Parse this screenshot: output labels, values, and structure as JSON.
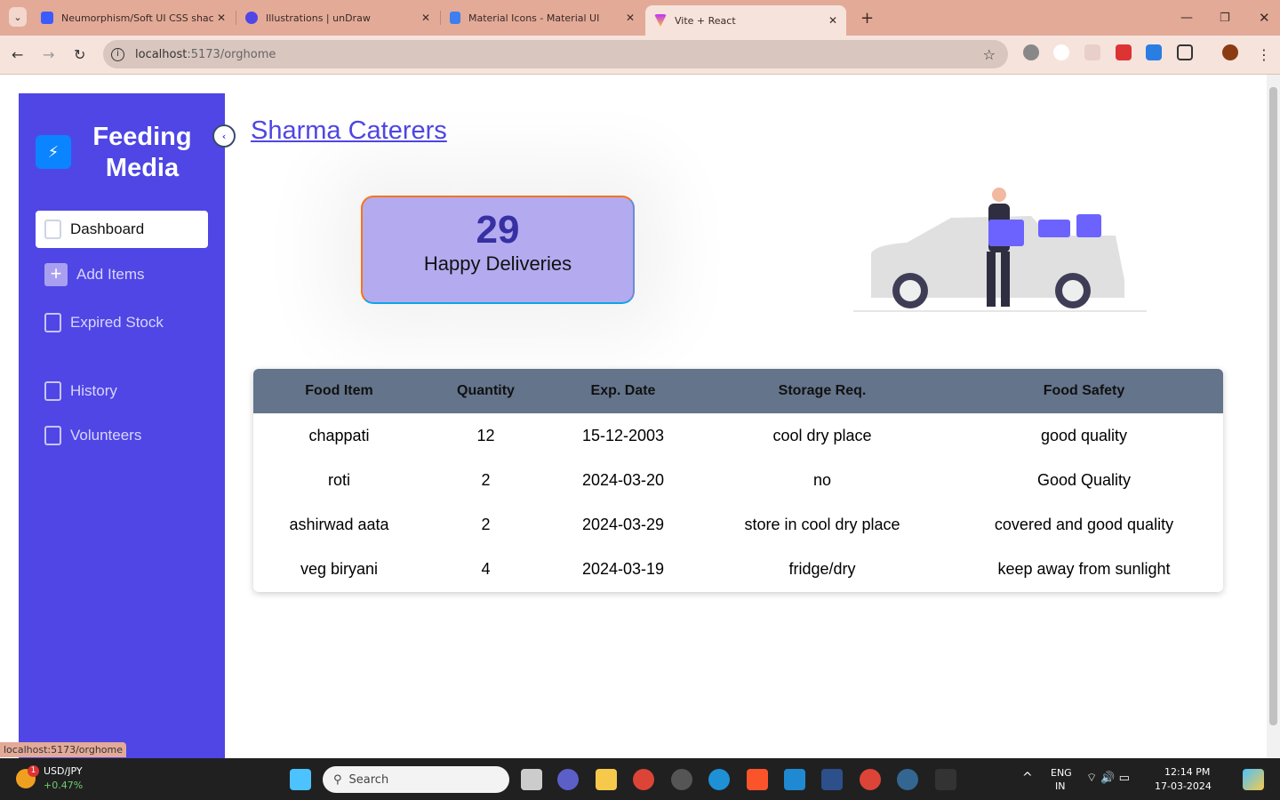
{
  "browser": {
    "tabs": [
      {
        "title": "Neumorphism/Soft UI CSS shac",
        "icon": "blue-square-icon"
      },
      {
        "title": "Illustrations | unDraw",
        "icon": "undraw-icon"
      },
      {
        "title": "Material Icons - Material UI",
        "icon": "mui-icon"
      },
      {
        "title": "Vite + React",
        "icon": "vite-icon",
        "active": true
      }
    ],
    "url_host": "localhost",
    "url_rest": ":5173/orghome",
    "status_url": "localhost:5173/orghome"
  },
  "sidebar": {
    "brand": "Feeding Media",
    "items": [
      {
        "label": "Dashboard",
        "active": true,
        "icon": "calendar-icon"
      },
      {
        "label": "Add Items",
        "icon": "plus-icon"
      },
      {
        "label": "Expired Stock",
        "icon": "calendar-icon"
      },
      {
        "label": "History",
        "icon": "chart-icon"
      },
      {
        "label": "Volunteers",
        "icon": "folder-icon"
      }
    ]
  },
  "main": {
    "title": "Sharma Caterers",
    "stat": {
      "value": "29",
      "label": "Happy Deliveries"
    },
    "table": {
      "headers": [
        "Food Item",
        "Quantity",
        "Exp. Date",
        "Storage Req.",
        "Food Safety"
      ],
      "rows": [
        [
          "chappati",
          "12",
          "15-12-2003",
          "cool dry place",
          "good quality"
        ],
        [
          "roti",
          "2",
          "2024-03-20",
          "no",
          "Good Quality"
        ],
        [
          "ashirwad aata",
          "2",
          "2024-03-29",
          "store in cool dry place",
          "covered and good quality"
        ],
        [
          "veg biryani",
          "4",
          "2024-03-19",
          "fridge/dry",
          "keep away from sunlight"
        ]
      ]
    }
  },
  "taskbar": {
    "ticker": "USD/JPY",
    "ticker_change": "+0.47%",
    "badge": "1",
    "search": "Search",
    "lang1": "ENG",
    "lang2": "IN",
    "time": "12:14 PM",
    "date": "17-03-2024"
  },
  "colors": {
    "sidebar": "#4f46e5",
    "accent": "#4f46e5",
    "table_header": "#64748b",
    "card": "#b4aaef"
  }
}
